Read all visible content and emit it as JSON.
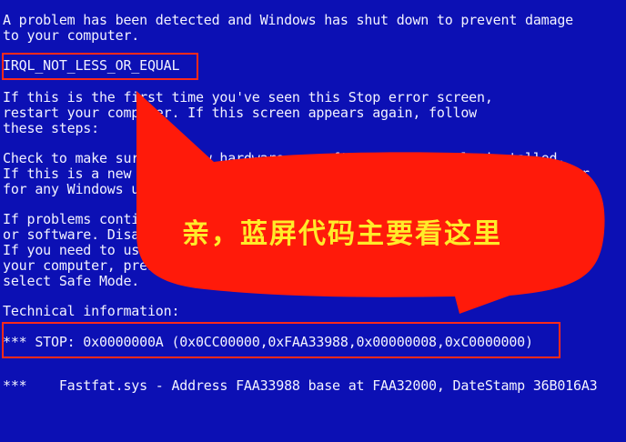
{
  "bsod": {
    "lines": [
      "A problem has been detected and Windows has shut down to prevent damage",
      "to your computer.",
      "",
      "IRQL_NOT_LESS_OR_EQUAL",
      "",
      "If this is the first time you've seen this Stop error screen,",
      "restart your computer. If this screen appears again, follow",
      "these steps:",
      "",
      "Check to make sure any new hardware or software is properly installed.",
      "If this is a new installation, ask your hardware or software manufacturer",
      "for any Windows updates you might need.",
      "",
      "If problems continue, disable or remove any newly installed hardware",
      "or software. Disable BIOS memory options such as caching or shadowing.",
      "If you need to use Safe Mode to remove or disable components, restart",
      "your computer, press F8 to select Advanced Startup Options, and then",
      "select Safe Mode.",
      "",
      "Technical information:",
      "",
      "*** STOP: 0x0000000A (0x0CC00000,0xFAA33988,0x00000008,0xC0000000)",
      "",
      "",
      "***    Fastfat.sys - Address FAA33988 base at FAA32000, DateStamp 36B016A3"
    ]
  },
  "annotation": {
    "callout_text": "亲，蓝屏代码主要看这里",
    "callout_color": "#ff1a0a",
    "text_color": "#ffeb2a",
    "box_color": "#ff2a1a"
  }
}
